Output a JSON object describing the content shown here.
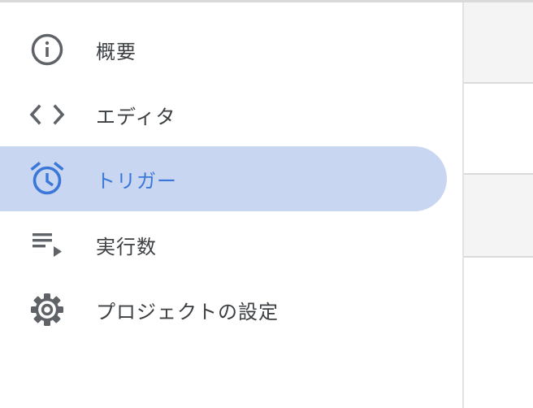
{
  "sidebar": {
    "items": [
      {
        "label": "概要",
        "icon": "info-icon",
        "active": false
      },
      {
        "label": "エディタ",
        "icon": "code-icon",
        "active": false
      },
      {
        "label": "トリガー",
        "icon": "alarm-clock-icon",
        "active": true
      },
      {
        "label": "実行数",
        "icon": "playlist-play-icon",
        "active": false
      },
      {
        "label": "プロジェクトの設定",
        "icon": "gear-icon",
        "active": false
      }
    ]
  },
  "colors": {
    "active_background": "#c8d6f1",
    "active_accent": "#3a77d9",
    "icon_default": "#5f6368",
    "text_default": "#3c4043"
  }
}
